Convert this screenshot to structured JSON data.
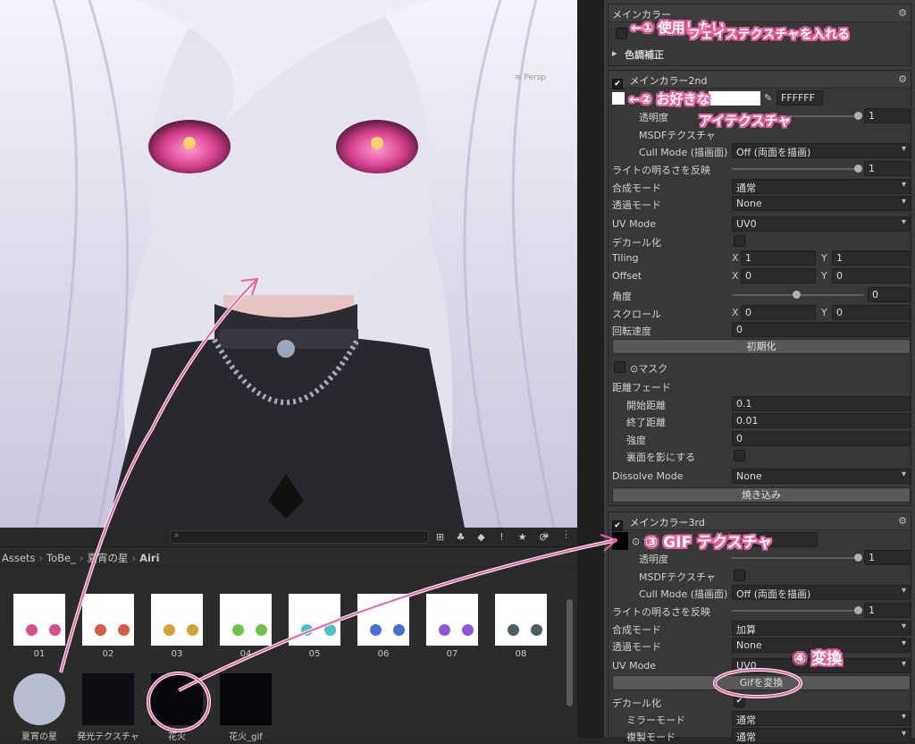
{
  "scene": {
    "persp_label": "≡ Persp"
  },
  "project": {
    "search": {
      "placeholder": ""
    },
    "breadcrumb": [
      "Assets",
      "ToBe_",
      "夏宵の星",
      "Airi"
    ],
    "items": [
      {
        "label": "01",
        "eye": "#d84f8e"
      },
      {
        "label": "02",
        "eye": "#d65a45"
      },
      {
        "label": "03",
        "eye": "#d3a33a"
      },
      {
        "label": "04",
        "eye": "#6fbf4a"
      },
      {
        "label": "05",
        "eye": "#4dc2c9"
      },
      {
        "label": "06",
        "eye": "#4a6fd1"
      },
      {
        "label": "07",
        "eye": "#8f57d6"
      },
      {
        "label": "08",
        "eye": "#4f5e63"
      }
    ],
    "items2": [
      {
        "label": "夏宵の星"
      },
      {
        "label": "発光テクスチャ"
      },
      {
        "label": "花火"
      },
      {
        "label": "花火_gif"
      }
    ]
  },
  "inspector": {
    "main_color": {
      "title": "メインカラー",
      "color_correction": "色調補正"
    },
    "main2": {
      "title": "メインカラー2nd",
      "hex": "FFFFFF",
      "opacity_label": "透明度",
      "opacity": "1",
      "msdf_label": "MSDFテクスチャ",
      "cull_label": "Cull Mode (描画面)",
      "cull_value": "Off (両面を描画)",
      "light_label": "ライトの明るさを反映",
      "light": "1",
      "blend_label": "合成モード",
      "blend_value": "通常",
      "alpha_label": "透過モード",
      "alpha_value": "None",
      "uv_label": "UV Mode",
      "uv_value": "UV0",
      "decal_label": "デカール化",
      "tiling_label": "Tiling",
      "tiling_x": "1",
      "tiling_y": "1",
      "offset_label": "Offset",
      "offset_x": "0",
      "offset_y": "0",
      "angle_label": "角度",
      "angle": "0",
      "scroll_label": "スクロール",
      "scroll_x": "0",
      "scroll_y": "0",
      "rotspeed_label": "回転速度",
      "rotspeed": "0",
      "reset_label": "初期化",
      "mask_label": "⊙マスク",
      "dist_label": "距離フェード",
      "start_label": "開始距離",
      "start": "0.1",
      "end_label": "終了距離",
      "end": "0.01",
      "strength_label": "強度",
      "strength": "0",
      "backface_label": "裏面を影にする",
      "dissolve_label": "Dissolve Mode",
      "dissolve_value": "None",
      "bake_label": "焼き込み"
    },
    "main3": {
      "title": "メインカラー3rd",
      "color_label": "⊙ 色",
      "hex_partial": "FF",
      "opacity_label": "透明度",
      "opacity": "1",
      "msdf_label": "MSDFテクスチャ",
      "cull_label": "Cull Mode (描画面)",
      "cull_value": "Off (両面を描画)",
      "light_label": "ライトの明るさを反映",
      "light": "1",
      "blend_label": "合成モード",
      "blend_value": "加算",
      "alpha_label": "透過モード",
      "alpha_value": "None",
      "uv_label": "UV Mode",
      "uv_value": "UV0",
      "gif_label": "Gifを変換",
      "decal_label": "デカール化",
      "mirror_label": "ミラーモード",
      "mirror_value": "通常",
      "copy_label": "複製モード",
      "copy_value": "通常"
    }
  },
  "notes": {
    "n1a": "←① 使用したい",
    "n1b": "フェイステクスチャを入れる",
    "n2a": "←② お好きな",
    "n2b": "アイテクスチャ",
    "n3": "③ GIF テクスチャ",
    "n4": "④ 変換"
  },
  "colors": {
    "accent_pink": "#e8619c",
    "inspector_bg": "#3c3c3c"
  }
}
